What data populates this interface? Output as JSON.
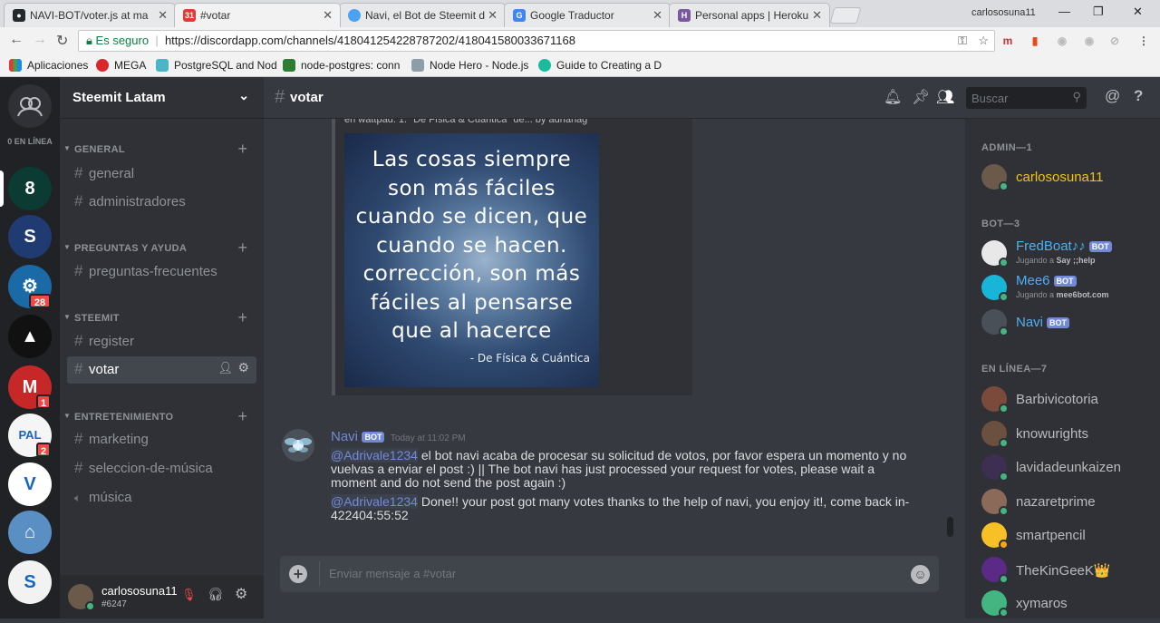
{
  "browser": {
    "tabs": [
      {
        "title": "NAVI-BOT/voter.js at ma",
        "favicon": "github-icon",
        "color": "#24292e",
        "glyph": "●"
      },
      {
        "title": "#votar",
        "favicon": "calendar-icon",
        "color": "#e53935",
        "glyph": "31"
      },
      {
        "title": "Navi, el Bot de Steemit d",
        "favicon": "steemit-icon",
        "color": "#4ba2f2",
        "glyph": "●"
      },
      {
        "title": "Google Traductor",
        "favicon": "translate-icon",
        "color": "#4285f4",
        "glyph": "G"
      },
      {
        "title": "Personal apps | Heroku",
        "favicon": "heroku-icon",
        "color": "#79589f",
        "glyph": "H"
      }
    ],
    "profile_name": "carlososuna11",
    "secure_label": "Es seguro",
    "url": "https://discordapp.com/channels/418041254228787202/418041580033671168",
    "bookmarks": [
      {
        "label": "Aplicaciones",
        "icon": "apps-grid-icon",
        "color": "#e53935"
      },
      {
        "label": "MEGA",
        "icon": "mega-icon",
        "color": "#d9272e"
      },
      {
        "label": "PostgreSQL and Nod",
        "icon": "postgres-icon",
        "color": "#4bb5c5"
      },
      {
        "label": "node-postgres: conn",
        "icon": "node-icon",
        "color": "#2e7d32"
      },
      {
        "label": "Node Hero - Node.js",
        "icon": "nodehero-icon",
        "color": "#8d9ea8"
      },
      {
        "label": "Guide to Creating a D",
        "icon": "guide-icon",
        "color": "#1abc9c"
      }
    ]
  },
  "guilds": {
    "online_label": "0 EN LÍNEA",
    "items": [
      {
        "name": "guild-1",
        "color": "#0b3b33",
        "glyph": "8",
        "badge": ""
      },
      {
        "name": "guild-2",
        "color": "#1f3b72",
        "glyph": "S",
        "badge": ""
      },
      {
        "name": "guild-3",
        "color": "#1b6aa8",
        "glyph": "⚙",
        "badge": "28"
      },
      {
        "name": "guild-4",
        "color": "#111111",
        "glyph": "▲",
        "badge": ""
      },
      {
        "name": "guild-5",
        "color": "#c62828",
        "glyph": "M",
        "badge": "1"
      },
      {
        "name": "guild-6",
        "color": "#f5f5f5",
        "glyph": "PAL",
        "badge": "2"
      },
      {
        "name": "guild-7",
        "color": "#ffffff",
        "glyph": "V",
        "badge": ""
      },
      {
        "name": "guild-8",
        "color": "#5a8fc4",
        "glyph": "⌂",
        "badge": ""
      },
      {
        "name": "guild-9",
        "color": "#f2f2f2",
        "glyph": "S",
        "badge": ""
      }
    ]
  },
  "server": {
    "name": "Steemit Latam",
    "categories": [
      {
        "label": "GENERAL",
        "channels": [
          "general",
          "administradores"
        ]
      },
      {
        "label": "PREGUNTAS Y AYUDA",
        "channels": [
          "preguntas-frecuentes"
        ]
      },
      {
        "label": "STEEMIT",
        "channels": [
          "register",
          "votar"
        ]
      },
      {
        "label": "ENTRETENIMIENTO",
        "channels": [
          "marketing",
          "seleccion-de-música",
          "música"
        ]
      }
    ],
    "active_channel": "votar"
  },
  "user": {
    "name": "carlososuna11",
    "tag": "#6247"
  },
  "channel_header": {
    "name": "votar",
    "search_placeholder": "Buscar"
  },
  "messages": {
    "truncated_text": "en wattpad.     1.  \"De Física & Cuántica\" de... by adrianag",
    "image_quote_lines": [
      "Las cosas siempre",
      "son más fáciles",
      "cuando se dicen, que",
      "cuando se hacen.",
      "corrección, son más",
      "fáciles al pensarse",
      "que al hacerce"
    ],
    "image_attribution": "- De Física & Cuántica",
    "author": "Navi",
    "bot_tag": "BOT",
    "timestamp": "Today at 11:02 PM",
    "msg1_mention": "@Adrivale1234",
    "msg1_text": " el bot navi acaba de procesar su solicitud de votos, por favor espera un momento y no vuelvas a enviar el post :) || The bot navi has just processed your request for votes, please wait a moment and do not send the post again :)",
    "msg2_mention": "@Adrivale1234",
    "msg2_text": " Done!! your post got many votes thanks to the help of navi, you enjoy it!, come back in-422404:55:52",
    "input_placeholder": "Enviar mensaje a #votar"
  },
  "members": {
    "admin_label": "ADMIN—1",
    "bot_label": "BOT—3",
    "online_label": "EN LÍNEA—7",
    "admin": [
      {
        "name": "carlososuna11",
        "color": "#f1c40f",
        "avatar": "#6b5a4a",
        "status": "#43b581"
      }
    ],
    "bots": [
      {
        "name": "FredBoat♪♪",
        "sub_prefix": "Jugando a ",
        "sub_bold": "Say ;;help",
        "avatar": "#e8e8e8",
        "status": "#43b581"
      },
      {
        "name": "Mee6",
        "sub_prefix": "Jugando a ",
        "sub_bold": "mee6bot.com",
        "avatar": "#19b5d8",
        "status": "#43b581"
      },
      {
        "name": "Navi",
        "sub_prefix": "",
        "sub_bold": "",
        "avatar": "#4a5058",
        "status": "#43b581"
      }
    ],
    "online": [
      {
        "name": "Barbivicotoria",
        "avatar": "#7a4b3a",
        "status": "#43b581"
      },
      {
        "name": "knowurights",
        "avatar": "#6b4f3f",
        "status": "#43b581"
      },
      {
        "name": "lavidadeunkaizen",
        "avatar": "#3c2f52",
        "status": "#43b581"
      },
      {
        "name": "nazaretprime",
        "avatar": "#8c6a5a",
        "status": "#43b581"
      },
      {
        "name": "smartpencil",
        "avatar": "#f6c026",
        "status": "#faa61a"
      },
      {
        "name": "TheKinGeeK👑",
        "avatar": "#5b2a86",
        "status": "#43b581"
      },
      {
        "name": "xymaros",
        "avatar": "#43b581",
        "status": "#43b581"
      }
    ]
  }
}
